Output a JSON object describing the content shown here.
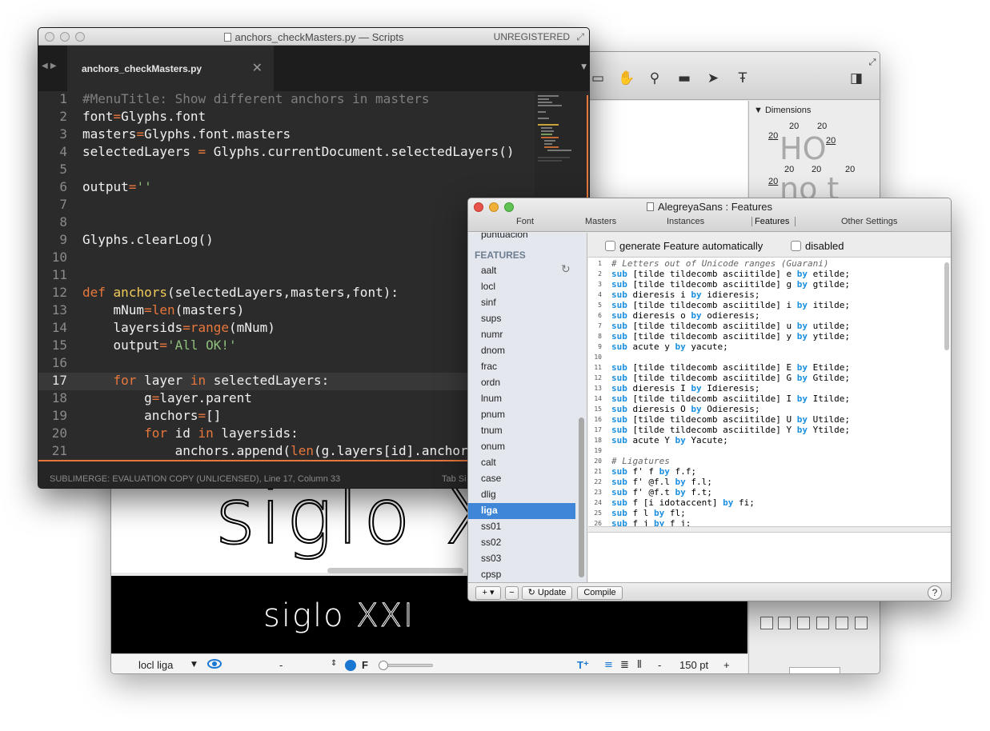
{
  "sublime": {
    "title": "anchors_checkMasters.py — Scripts",
    "unregistered": "UNREGISTERED",
    "tab_label": "anchors_checkMasters.py",
    "status_left": "SUBLIMERGE: EVALUATION COPY (UNLICENSED), Line 17, Column 33",
    "status_right": "Tab Si",
    "current_line": 17,
    "line_numbers": [
      "1",
      "2",
      "3",
      "4",
      "5",
      "6",
      "7",
      "8",
      "9",
      "10",
      "11",
      "12",
      "13",
      "14",
      "15",
      "16",
      "17",
      "18",
      "19",
      "20",
      "21"
    ]
  },
  "glyphs": {
    "canvas_text": "siglo X",
    "preview_text_a": "siglo",
    "preview_text_b": "XXI",
    "features_label": "locl liga",
    "dash": "-",
    "font_size": "150 pt",
    "format_f": "F",
    "plus": "+",
    "dimensions_label": "Dimensions",
    "metric_value": "20",
    "metric_sample_1": "HO",
    "metric_sample_2": "no t"
  },
  "features_window": {
    "title": "AlegreyaSans : Features",
    "tabs": [
      "Font",
      "Masters",
      "Instances",
      "Features",
      "Other Settings"
    ],
    "sidebar_cut_item": "puntuacion",
    "sidebar_heading": "FEATURES",
    "sidebar_items": [
      "aalt",
      "locl",
      "sinf",
      "sups",
      "numr",
      "dnom",
      "frac",
      "ordn",
      "lnum",
      "pnum",
      "tnum",
      "onum",
      "calt",
      "case",
      "dlig",
      "liga",
      "ss01",
      "ss02",
      "ss03",
      "cpsp"
    ],
    "selected_item": "liga",
    "checkbox_generate": "generate Feature automatically",
    "checkbox_disabled": "disabled",
    "code_line_numbers": [
      "1",
      "2",
      "3",
      "4",
      "5",
      "6",
      "7",
      "8",
      "9",
      "10",
      "11",
      "12",
      "13",
      "14",
      "15",
      "16",
      "17",
      "18",
      "19",
      "20",
      "21",
      "22",
      "23",
      "24",
      "25",
      "26"
    ],
    "button_update": "Update",
    "button_compile": "Compile",
    "button_help": "?",
    "button_add": "+ ▾",
    "button_remove": "−"
  },
  "colors": {
    "sublime_bg": "#2b2b2b",
    "sublime_accent": "#e8773c",
    "features_keyword": "#1a8fe0",
    "selection_blue": "#3f86d9"
  }
}
